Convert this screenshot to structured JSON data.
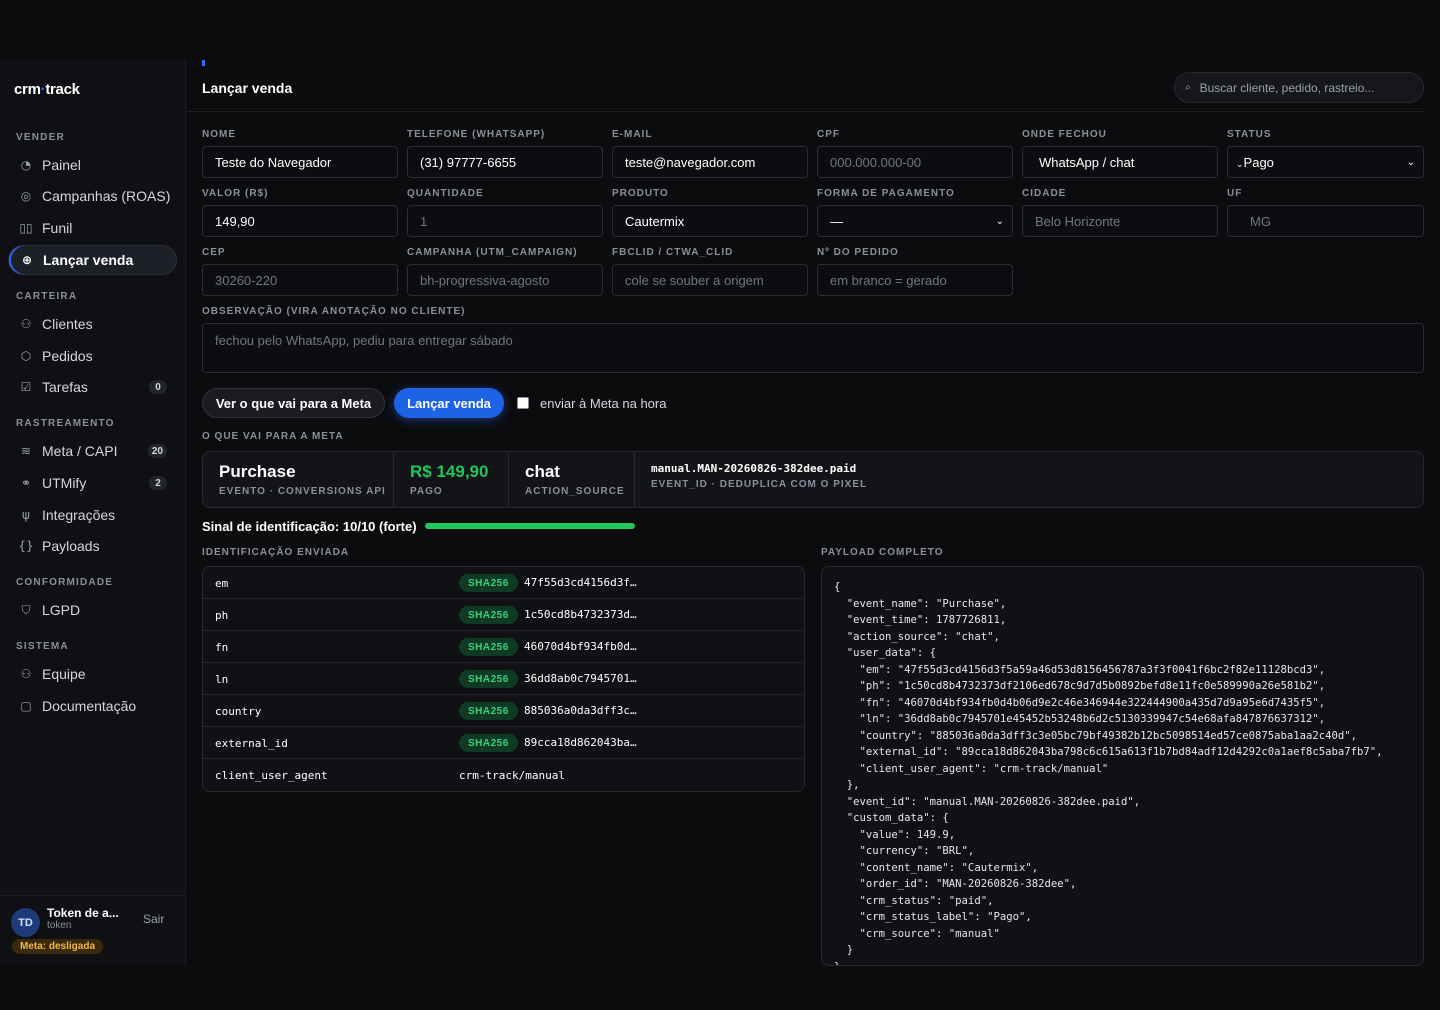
{
  "sidebar": {
    "logo_a": "crm",
    "logo_dot": "·",
    "logo_b": "track",
    "sections": {
      "vender": "VENDER",
      "carteira": "CARTEIRA",
      "rastreamento": "RASTREAMENTO",
      "conformidade": "CONFORMIDADE",
      "sistema": "SISTEMA"
    },
    "items": {
      "painel": "Painel",
      "campanhas": "Campanhas (ROAS)",
      "funil": "Funil",
      "lancar": "Lançar venda",
      "clientes": "Clientes",
      "pedidos": "Pedidos",
      "tarefas": "Tarefas",
      "tarefas_count": "0",
      "meta": "Meta / CAPI",
      "meta_count": "20",
      "utmify": "UTMify",
      "utmify_count": "2",
      "integracoes": "Integrações",
      "payloads": "Payloads",
      "lgpd": "LGPD",
      "equipe": "Equipe",
      "documentacao": "Documentação"
    },
    "user": {
      "initials": "TD",
      "name": "Token de a...",
      "role": "token",
      "logout": "Sair",
      "meta_status": "Meta: desligada"
    }
  },
  "header": {
    "title": "Lançar venda",
    "search_placeholder": "Buscar cliente, pedido, rastreio..."
  },
  "form": {
    "nome_label": "NOME",
    "nome_value": "Teste do Navegador",
    "telefone_label": "TELEFONE (WHATSAPP)",
    "telefone_value": "(31) 97777-6655",
    "email_label": "E-MAIL",
    "email_value": "teste@navegador.com",
    "cpf_label": "CPF",
    "cpf_placeholder": "000.000.000-00",
    "onde_label": "ONDE FECHOU",
    "onde_value": "WhatsApp / chat",
    "status_label": "STATUS",
    "status_value": "Pago",
    "valor_label": "VALOR (R$)",
    "valor_value": "149,90",
    "quantidade_label": "QUANTIDADE",
    "quantidade_value": "1",
    "produto_label": "PRODUTO",
    "produto_value": "Cautermix",
    "pagamento_label": "FORMA DE PAGAMENTO",
    "pagamento_value": "—",
    "cidade_label": "CIDADE",
    "cidade_placeholder": "Belo Horizonte",
    "uf_label": "UF",
    "uf_placeholder": "MG",
    "cep_label": "CEP",
    "cep_placeholder": "30260-220",
    "campanha_label": "CAMPANHA (UTM_CAMPAIGN)",
    "campanha_placeholder": "bh-progressiva-agosto",
    "fbclid_label": "FBCLID / CTWA_CLID",
    "fbclid_placeholder": "cole se souber a origem",
    "pedido_label": "Nº DO PEDIDO",
    "pedido_placeholder": "em branco = gerado",
    "obs_label": "OBSERVAÇÃO (VIRA ANOTAÇÃO NO CLIENTE)",
    "obs_placeholder": "fechou pelo WhatsApp, pediu para entregar sábado"
  },
  "actions": {
    "preview": "Ver o que vai para a Meta",
    "submit": "Lançar venda",
    "send_now": "enviar à Meta na hora"
  },
  "meta_preview": {
    "section_label": "O QUE VAI PARA A META",
    "event": "Purchase",
    "event_label": "EVENTO · CONVERSIONS API",
    "value": "R$ 149,90",
    "value_label": "PAGO",
    "source": "chat",
    "source_label": "ACTION_SOURCE",
    "event_id": "manual.MAN-20260826-382dee.paid",
    "event_id_label": "EVENT_ID · DEDUPLICA COM O PIXEL",
    "signal_text": "Sinal de identificação: 10/10 (forte)",
    "signal_fraction": 1.0
  },
  "identification": {
    "label": "IDENTIFICAÇÃO ENVIADA",
    "rows": [
      {
        "key": "em",
        "tag": "SHA256",
        "value": "47f55d3cd4156d3f…"
      },
      {
        "key": "ph",
        "tag": "SHA256",
        "value": "1c50cd8b4732373d…"
      },
      {
        "key": "fn",
        "tag": "SHA256",
        "value": "46070d4bf934fb0d…"
      },
      {
        "key": "ln",
        "tag": "SHA256",
        "value": "36dd8ab0c7945701…"
      },
      {
        "key": "country",
        "tag": "SHA256",
        "value": "885036a0da3dff3c…"
      },
      {
        "key": "external_id",
        "tag": "SHA256",
        "value": "89cca18d862043ba…"
      },
      {
        "key": "client_user_agent",
        "tag": "",
        "value": "crm-track/manual"
      }
    ]
  },
  "payload": {
    "label": "PAYLOAD COMPLETO",
    "text": "{\n  \"event_name\": \"Purchase\",\n  \"event_time\": 1787726811,\n  \"action_source\": \"chat\",\n  \"user_data\": {\n    \"em\": \"47f55d3cd4156d3f5a59a46d53d8156456787a3f3f0041f6bc2f82e11128bcd3\",\n    \"ph\": \"1c50cd8b4732373df2106ed678c9d7d5b0892befd8e11fc0e589990a26e581b2\",\n    \"fn\": \"46070d4bf934fb0d4b06d9e2c46e346944e322444900a435d7d9a95e6d7435f5\",\n    \"ln\": \"36dd8ab0c7945701e45452b53248b6d2c5130339947c54e68afa847876637312\",\n    \"country\": \"885036a0da3dff3c3e05bc79bf49382b12bc5098514ed57ce0875aba1aa2c40d\",\n    \"external_id\": \"89cca18d862043ba798c6c615a613f1b7bd84adf12d4292c0a1aef8c5aba7fb7\",\n    \"client_user_agent\": \"crm-track/manual\"\n  },\n  \"event_id\": \"manual.MAN-20260826-382dee.paid\",\n  \"custom_data\": {\n    \"value\": 149.9,\n    \"currency\": \"BRL\",\n    \"content_name\": \"Cautermix\",\n    \"order_id\": \"MAN-20260826-382dee\",\n    \"crm_status\": \"paid\",\n    \"crm_status_label\": \"Pago\",\n    \"crm_source\": \"manual\"\n  }\n}"
  },
  "colors": {
    "accent": "#1e62e6",
    "success": "#22c55e",
    "warning": "#f2b84b"
  }
}
